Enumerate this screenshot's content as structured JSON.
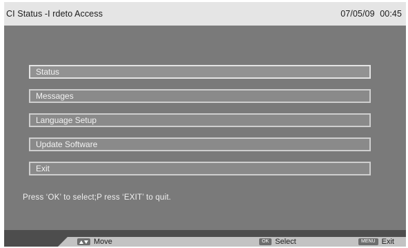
{
  "header": {
    "title": "CI Status -I rdeto Access",
    "datetime": "07/05/09 00:45"
  },
  "menu": {
    "items": [
      {
        "label": "Status",
        "selected": true
      },
      {
        "label": "Messages",
        "selected": false
      },
      {
        "label": "Language Setup",
        "selected": false
      },
      {
        "label": "Update Software",
        "selected": false
      },
      {
        "label": "Exit",
        "selected": false
      }
    ]
  },
  "hint_text": "Press ‘OK’ to select;P ress ‘EXIT’ to quit.",
  "footer": {
    "move": {
      "icon": "up-down-arrows-icon",
      "label": "Move"
    },
    "select": {
      "key": "OK",
      "label": "Select"
    },
    "exit": {
      "key": "MENU",
      "label": "Exit"
    }
  },
  "colors": {
    "background": "#7a7a7a",
    "titlebar": "#e5e5e5",
    "item_border": "#cfcfcf",
    "footer_bar": "#c3c3c3"
  }
}
